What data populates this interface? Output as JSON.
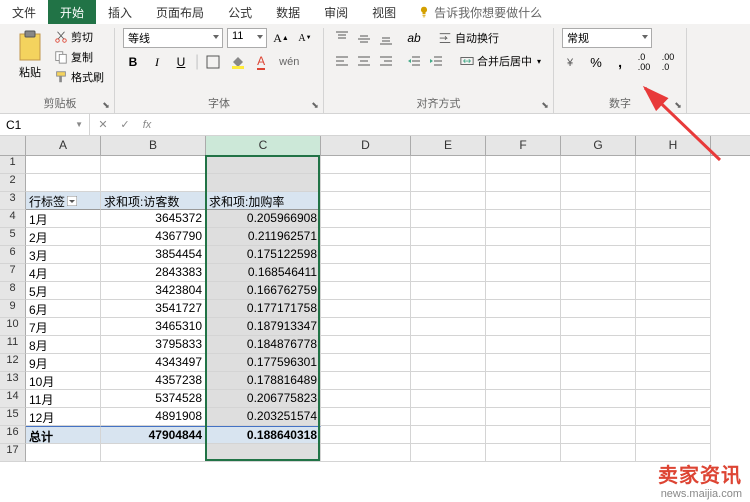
{
  "menu": {
    "file": "文件",
    "home": "开始",
    "insert": "插入",
    "layout": "页面布局",
    "formulas": "公式",
    "data": "数据",
    "review": "审阅",
    "view": "视图",
    "tell_me": "告诉我你想要做什么"
  },
  "ribbon": {
    "clipboard": {
      "paste": "粘贴",
      "cut": "剪切",
      "copy": "复制",
      "format_painter": "格式刷",
      "label": "剪贴板"
    },
    "font": {
      "name": "等线",
      "size": "11",
      "label": "字体"
    },
    "alignment": {
      "wrap": "自动换行",
      "merge": "合并后居中",
      "label": "对齐方式"
    },
    "number": {
      "format": "常规",
      "label": "数字"
    }
  },
  "namebox": "C1",
  "columns": [
    "A",
    "B",
    "C",
    "D",
    "E",
    "F",
    "G",
    "H"
  ],
  "row_numbers": [
    1,
    2,
    3,
    4,
    5,
    6,
    7,
    8,
    9,
    10,
    11,
    12,
    13,
    14,
    15,
    16,
    17
  ],
  "table": {
    "header_a": "行标签",
    "header_b": "求和项:访客数",
    "header_c": "求和项:加购率",
    "rows": [
      {
        "label": "1月",
        "visitors": "3645372",
        "rate": "0.205966908"
      },
      {
        "label": "2月",
        "visitors": "4367790",
        "rate": "0.211962571"
      },
      {
        "label": "3月",
        "visitors": "3854454",
        "rate": "0.175122598"
      },
      {
        "label": "4月",
        "visitors": "2843383",
        "rate": "0.168546411"
      },
      {
        "label": "5月",
        "visitors": "3423804",
        "rate": "0.166762759"
      },
      {
        "label": "6月",
        "visitors": "3541727",
        "rate": "0.177171758"
      },
      {
        "label": "7月",
        "visitors": "3465310",
        "rate": "0.187913347"
      },
      {
        "label": "8月",
        "visitors": "3795833",
        "rate": "0.184876778"
      },
      {
        "label": "9月",
        "visitors": "4343497",
        "rate": "0.177596301"
      },
      {
        "label": "10月",
        "visitors": "4357238",
        "rate": "0.178816489"
      },
      {
        "label": "11月",
        "visitors": "5374528",
        "rate": "0.206775823"
      },
      {
        "label": "12月",
        "visitors": "4891908",
        "rate": "0.203251574"
      }
    ],
    "total_label": "总计",
    "total_visitors": "47904844",
    "total_rate": "0.188640318"
  },
  "watermark": {
    "title": "卖家资讯",
    "url": "news.maijia.com"
  }
}
